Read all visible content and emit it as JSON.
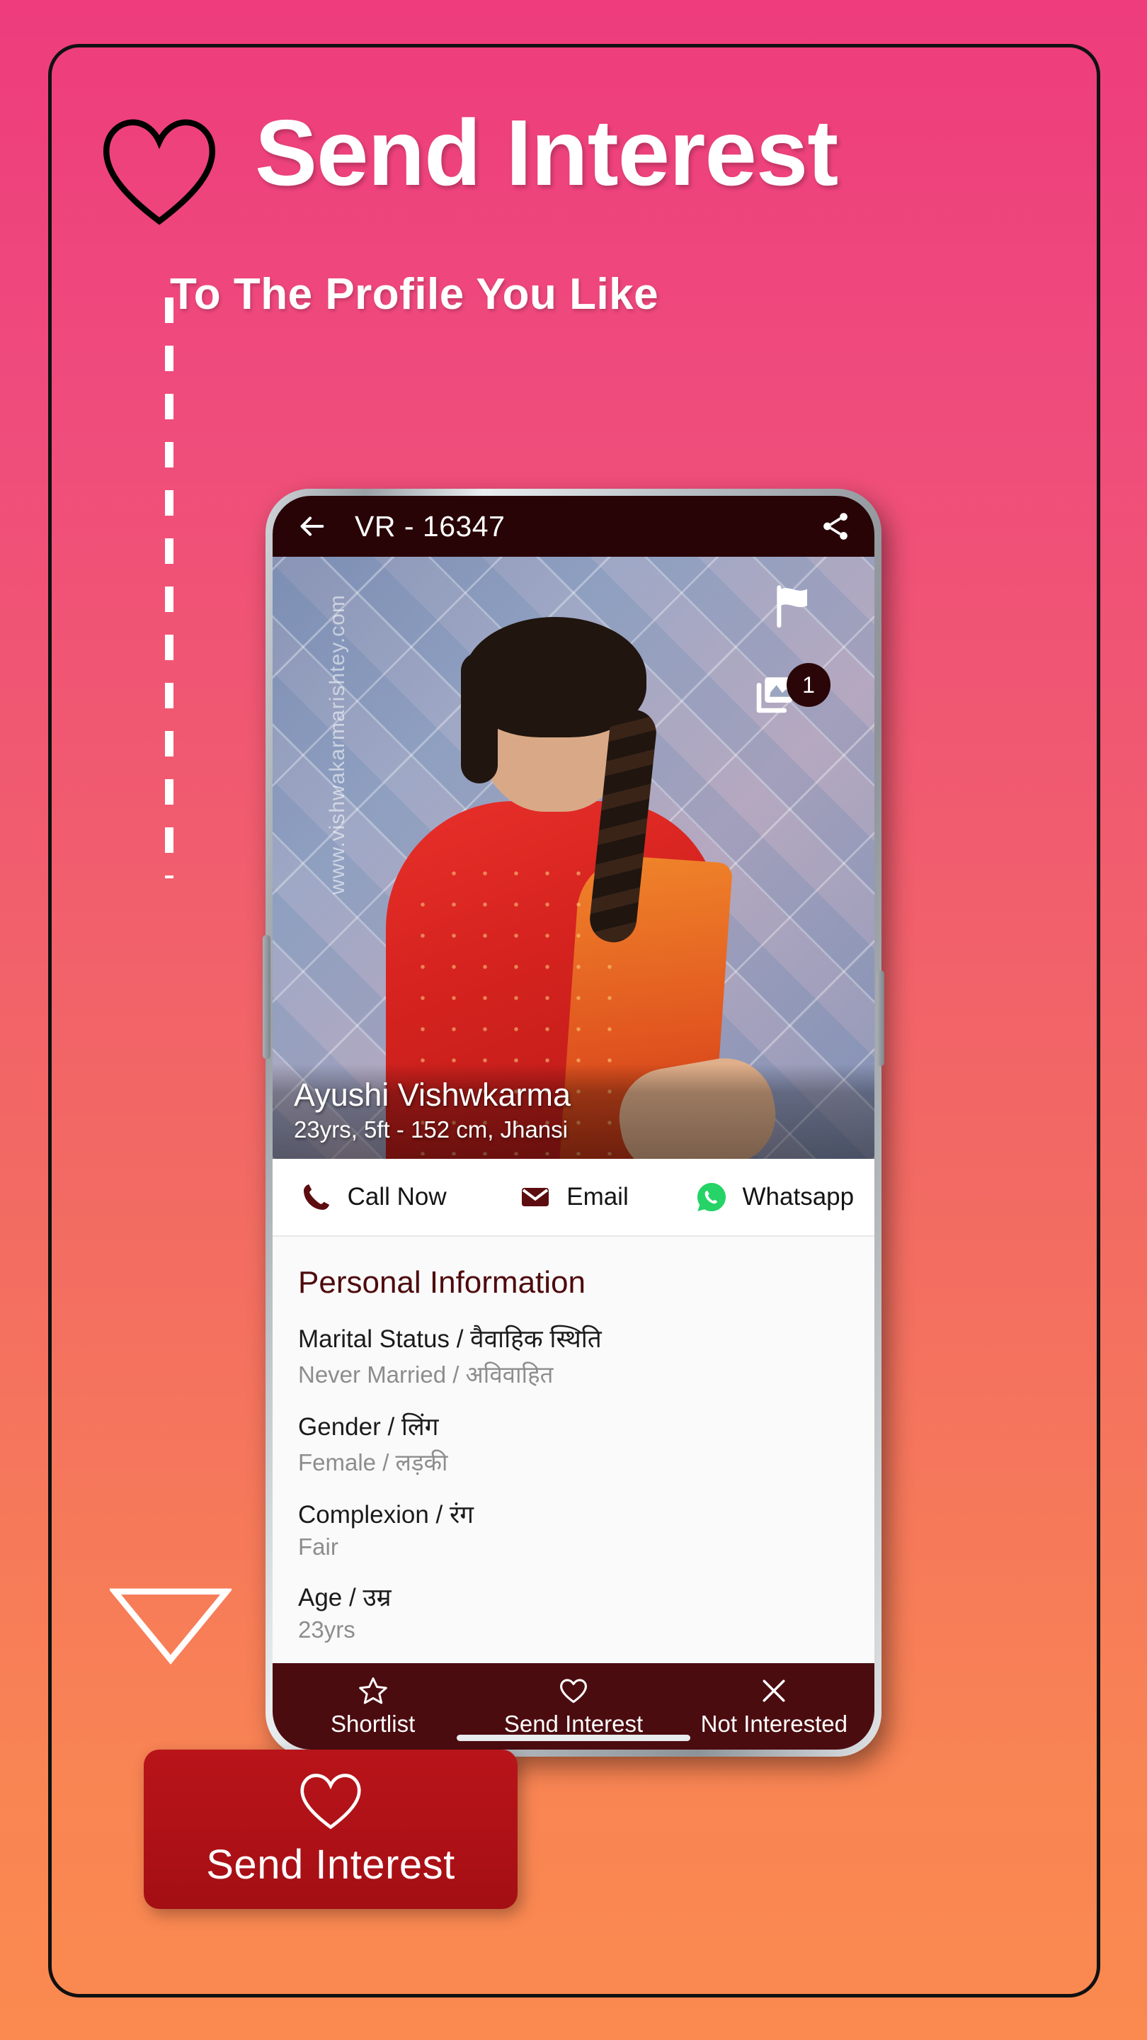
{
  "promo": {
    "headline": "Send Interest",
    "subheadline": "To The Profile You Like",
    "heart_icon": "heart-outline-icon",
    "arrow_icon": "triangle-down-arrow-icon",
    "background_gradient_top": "#ee3c7c",
    "background_gradient_bottom": "#fa8a50"
  },
  "cta_card": {
    "label": "Send Interest",
    "icon": "heart-outline-icon",
    "background_color": "#b1141a"
  },
  "app": {
    "app_bar": {
      "back_icon": "back-arrow-icon",
      "title": "VR - 16347",
      "share_icon": "share-icon",
      "background_color": "#280406"
    },
    "photo": {
      "watermark": "www.vishwakarmarishtey.com",
      "flag_icon": "flag-icon",
      "gallery_icon": "photo-library-icon",
      "gallery_count": "1",
      "profile_name": "Ayushi Vishwkarma",
      "profile_meta": "23yrs, 5ft - 152 cm, Jhansi"
    },
    "contacts": [
      {
        "label": "Call Now",
        "icon": "phone-icon",
        "color": "#5d0c10"
      },
      {
        "label": "Email",
        "icon": "envelope-icon",
        "color": "#5d0c10"
      },
      {
        "label": "Whatsapp",
        "icon": "whatsapp-icon",
        "color": "#25d366"
      }
    ],
    "details": {
      "section_title": "Personal Information",
      "fields": [
        {
          "key": "Marital Status / वैवाहिक स्थिति",
          "value": "Never Married / अविवाहित"
        },
        {
          "key": "Gender / लिंग",
          "value": "Female / लड़की"
        },
        {
          "key": "Complexion / रंग",
          "value": "Fair"
        },
        {
          "key": "Age / उम्र",
          "value": "23yrs"
        }
      ]
    },
    "bottom_nav": {
      "background_color": "#4b0c10",
      "items": [
        {
          "label": "Shortlist",
          "icon": "star-outline-icon"
        },
        {
          "label": "Send Interest",
          "icon": "heart-outline-icon"
        },
        {
          "label": "Not Interested",
          "icon": "close-x-icon"
        }
      ]
    }
  }
}
